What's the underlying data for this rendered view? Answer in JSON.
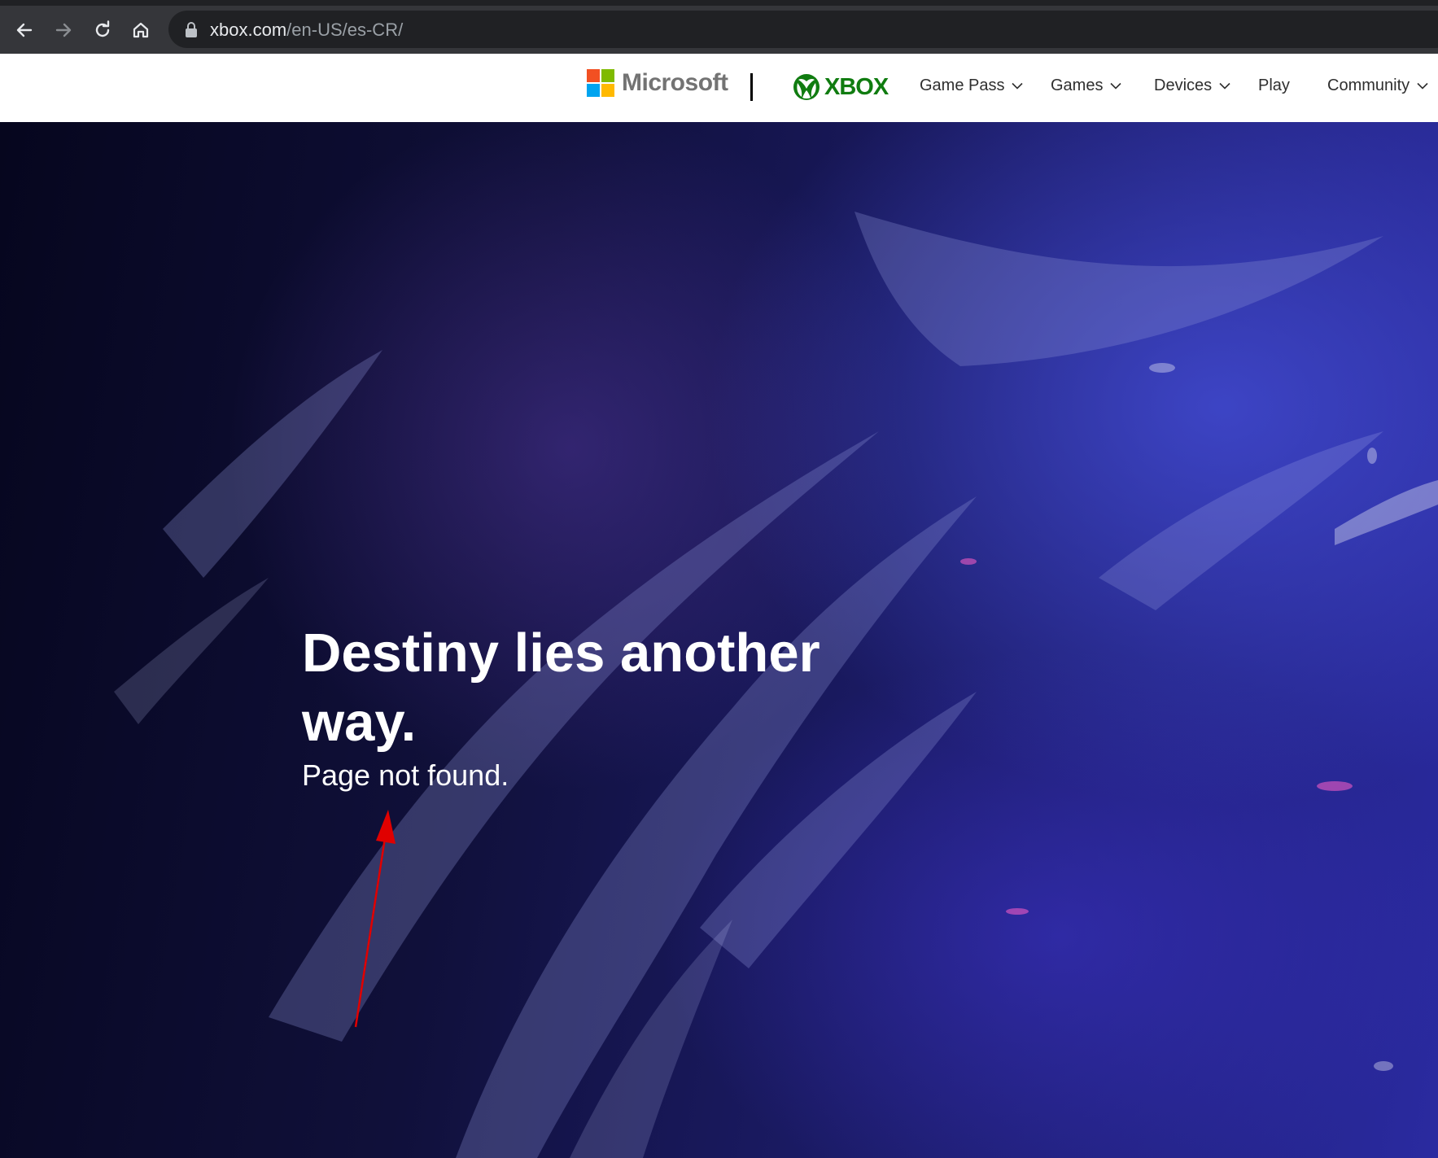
{
  "browser": {
    "url_domain": "xbox.com",
    "url_path": "/en-US/es-CR/"
  },
  "header": {
    "microsoft_label": "Microsoft",
    "xbox_label": "XBOX",
    "nav": [
      {
        "label": "Game Pass",
        "has_dropdown": true
      },
      {
        "label": "Games",
        "has_dropdown": true
      },
      {
        "label": "Devices",
        "has_dropdown": true
      },
      {
        "label": "Play",
        "has_dropdown": false
      },
      {
        "label": "Community",
        "has_dropdown": true
      }
    ]
  },
  "hero": {
    "title": "Destiny lies another way.",
    "subtitle": "Page not found."
  },
  "colors": {
    "xbox_green": "#107c10",
    "ms_red": "#f25022",
    "ms_green": "#7fba00",
    "ms_blue": "#00a4ef",
    "ms_yellow": "#ffb900",
    "annotation_arrow": "#e00000"
  }
}
